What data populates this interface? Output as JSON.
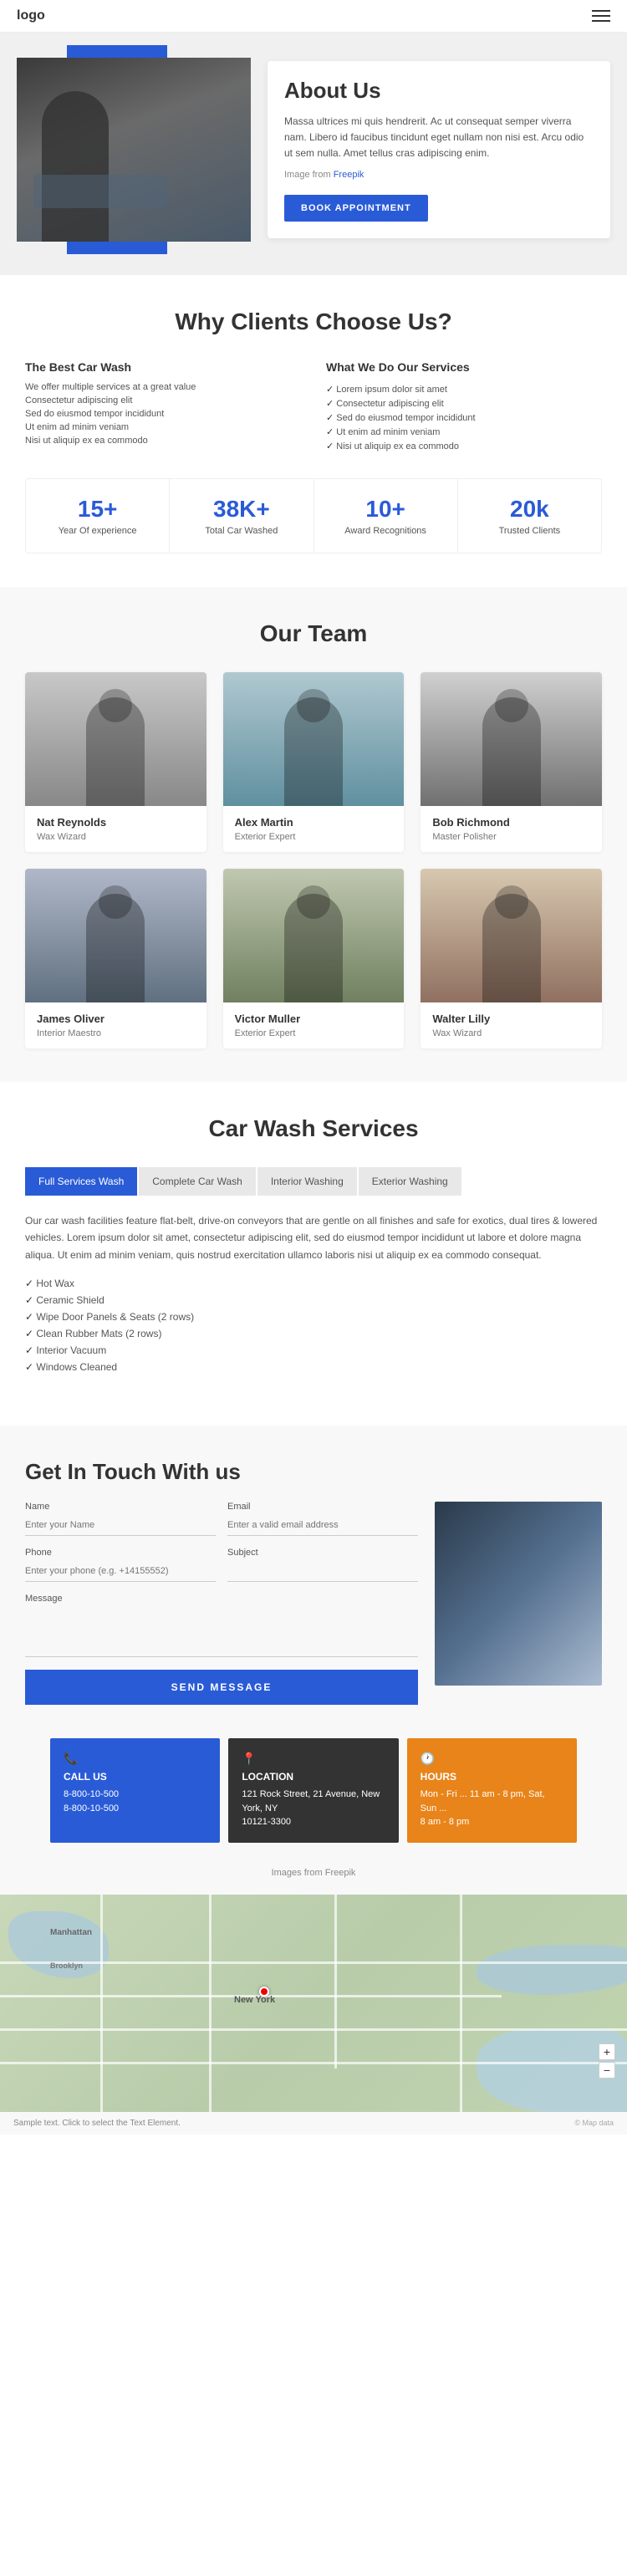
{
  "header": {
    "logo": "logo"
  },
  "hero": {
    "about_title": "About Us",
    "about_text": "Massa ultrices mi quis hendrerit. Ac ut consequat semper viverra nam. Libero id faucibus tincidunt eget nullam non nisi est. Arcu odio ut sem nulla. Amet tellus cras adipiscing enim.",
    "image_from_label": "Image from",
    "image_from_link": "Freepik",
    "book_btn": "BOOK APPOINTMENT"
  },
  "why": {
    "title": "Why Clients Choose Us?",
    "col1_title": "The Best Car Wash",
    "col1_text1": "We offer multiple services at a great value",
    "col1_text2": "Consectetur adipiscing elit",
    "col1_text3": "Sed do eiusmod tempor incididunt",
    "col1_text4": "Ut enim ad minim veniam",
    "col1_text5": "Nisi ut aliquip ex ea commodo",
    "col2_title": "What We Do Our Services",
    "col2_item1": "Lorem ipsum dolor sit amet",
    "col2_item2": "Consectetur adipiscing elit",
    "col2_item3": "Sed do eiusmod tempor incididunt",
    "col2_item4": "Ut enim ad minim veniam",
    "col2_item5": "Nisi ut aliquip ex ea commodo",
    "stats": [
      {
        "number": "15+",
        "label": "Year Of experience"
      },
      {
        "number": "38K+",
        "label": "Total Car Washed"
      },
      {
        "number": "10+",
        "label": "Award Recognitions"
      },
      {
        "number": "20k",
        "label": "Trusted Clients"
      }
    ]
  },
  "team": {
    "title": "Our Team",
    "members": [
      {
        "name": "Nat Reynolds",
        "role": "Wax Wizard"
      },
      {
        "name": "Alex Martin",
        "role": "Exterior Expert"
      },
      {
        "name": "Bob Richmond",
        "role": "Master Polisher"
      },
      {
        "name": "James Oliver",
        "role": "Interior Maestro"
      },
      {
        "name": "Victor Muller",
        "role": "Exterior Expert"
      },
      {
        "name": "Walter Lilly",
        "role": "Wax Wizard"
      }
    ]
  },
  "services": {
    "title": "Car Wash Services",
    "tabs": [
      {
        "label": "Full Services Wash",
        "active": true
      },
      {
        "label": "Complete Car Wash",
        "active": false
      },
      {
        "label": "Interior Washing",
        "active": false
      },
      {
        "label": "Exterior Washing",
        "active": false
      }
    ],
    "content_text": "Our car wash facilities feature flat-belt, drive-on conveyors that are gentle on all finishes and safe for exotics, dual tires & lowered vehicles. Lorem ipsum dolor sit amet, consectetur adipiscing elit, sed do eiusmod tempor incididunt ut labore et dolore magna aliqua. Ut enim ad minim veniam, quis nostrud exercitation ullamco laboris nisi ut aliquip ex ea commodo consequat.",
    "services_list": [
      "Hot Wax",
      "Ceramic Shield",
      "Wipe Door Panels & Seats (2 rows)",
      "Clean Rubber Mats (2 rows)",
      "Interior Vacuum",
      "Windows Cleaned"
    ]
  },
  "contact": {
    "title": "Get In Touch With us",
    "name_label": "Name",
    "name_placeholder": "Enter your Name",
    "email_label": "Email",
    "email_placeholder": "Enter a valid email address",
    "phone_label": "Phone",
    "phone_placeholder": "Enter your phone (e.g. +14155552)",
    "subject_label": "Subject",
    "subject_placeholder": "",
    "message_label": "Message",
    "send_btn": "SEND MESSAGE"
  },
  "info_boxes": [
    {
      "id": "call",
      "icon": "📞",
      "title": "CALL US",
      "line1": "8-800-10-500",
      "line2": "8-800-10-500"
    },
    {
      "id": "location",
      "icon": "📍",
      "title": "LOCATION",
      "line1": "121 Rock Street, 21 Avenue, New York, NY",
      "line2": "10121-3300"
    },
    {
      "id": "hours",
      "icon": "🕐",
      "title": "HOURS",
      "line1": "Mon - Fri ... 11 am - 8 pm, Sat, Sun ...",
      "line2": "8 am - 8 pm"
    }
  ],
  "images_from": "Images from Freepik",
  "map": {
    "label": "New York",
    "footer_text": "Sample text. Click to select the Text Element.",
    "zoom_in": "+",
    "zoom_out": "−"
  }
}
